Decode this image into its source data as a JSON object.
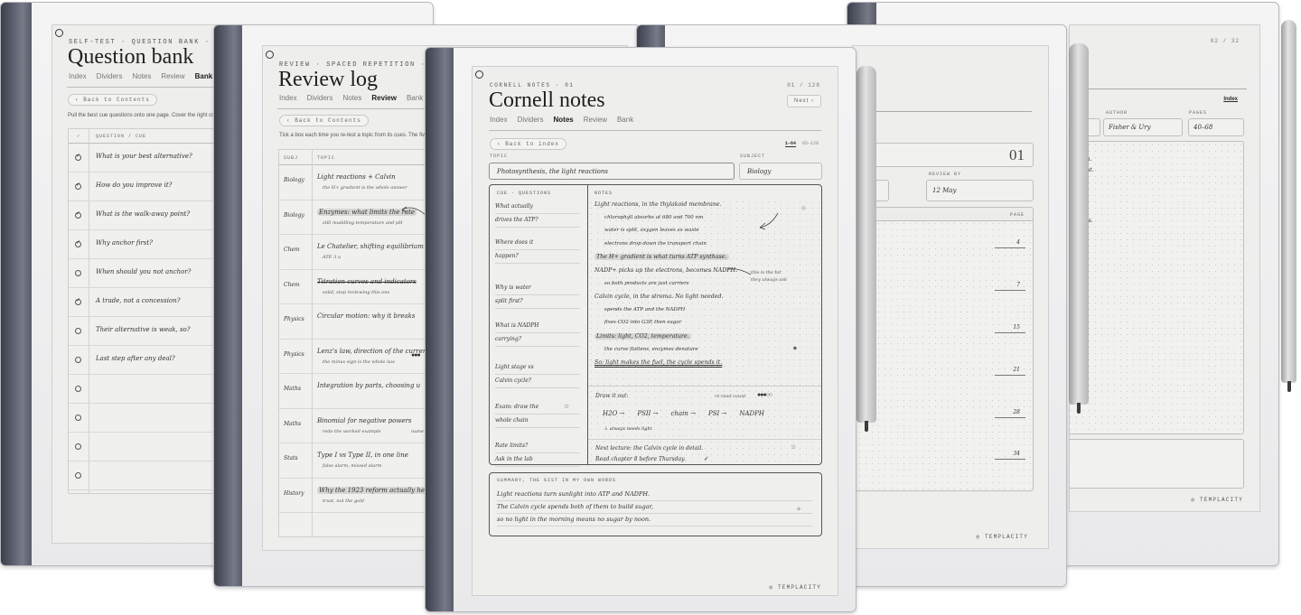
{
  "qbank": {
    "kicker": "SELF-TEST · QUESTION BANK · 01",
    "title": "Question bank",
    "tabs": [
      "Index",
      "Dividers",
      "Notes",
      "Review",
      "Bank"
    ],
    "active_tab": "Bank",
    "back": "‹ Back to Contents",
    "instruction": "Pull the best cue questions onto one page. Cover the right co",
    "col_check": "✓",
    "col_question": "QUESTION / CUE",
    "rows": [
      {
        "checked": true,
        "text": "What is your best alternative?"
      },
      {
        "checked": true,
        "text": "How do you improve it?"
      },
      {
        "checked": true,
        "text": "What is the walk-away point?"
      },
      {
        "checked": true,
        "text": "Why anchor first?"
      },
      {
        "checked": false,
        "text": "When should you not anchor?"
      },
      {
        "checked": true,
        "text": "A trade, not a concession?"
      },
      {
        "checked": false,
        "text": "Their alternative is weak, so?"
      },
      {
        "checked": false,
        "text": "Last step after any deal?"
      },
      {
        "checked": false,
        "text": ""
      },
      {
        "checked": false,
        "text": ""
      },
      {
        "checked": false,
        "text": ""
      },
      {
        "checked": false,
        "text": ""
      }
    ]
  },
  "review": {
    "kicker": "REVIEW · SPACED REPETITION · 01",
    "title": "Review log",
    "tabs": [
      "Index",
      "Dividers",
      "Notes",
      "Review",
      "Bank"
    ],
    "active_tab": "Review",
    "back": "‹ Back to Contents",
    "instruction": "Tick a box each time you re-test a topic from its cues. The fiv",
    "col_subject": "SUBJ",
    "col_topic": "TOPIC",
    "rows": [
      {
        "subject": "Biology",
        "topic": "Light reactions + Calvin",
        "note": "the H+ gradient is the whole answer",
        "style": "plain"
      },
      {
        "subject": "Biology",
        "topic": "Enzymes: what limits the rate",
        "note": "still muddling temperature and pH",
        "style": "hl"
      },
      {
        "subject": "Chem",
        "topic": "Le Chatelier, shifting equilibrium",
        "note": "ATP. 3 a",
        "style": "plain"
      },
      {
        "subject": "Chem",
        "topic": "Titration curves and indicators",
        "note": "solid, stop reviewing this one",
        "style": "strike"
      },
      {
        "subject": "Physics",
        "topic": "Circular motion: why it breaks",
        "note": "",
        "style": "plain"
      },
      {
        "subject": "Physics",
        "topic": "Lenz's law, direction of the current",
        "note": "the minus sign is the whole law",
        "style": "plain"
      },
      {
        "subject": "Maths",
        "topic": "Integration by parts, choosing u",
        "note": "",
        "style": "plain"
      },
      {
        "subject": "Maths",
        "topic": "Binomial for negative powers",
        "note": "redo the worked example",
        "style": "plain"
      },
      {
        "subject": "Stats",
        "topic": "Type I vs Type II, in one line",
        "note": "false alarm, missed alarm",
        "style": "plain"
      },
      {
        "subject": "History",
        "topic": "Why the 1923 reform actually held",
        "note": "trust, not the gold",
        "style": "hl"
      }
    ],
    "side_note": "name the"
  },
  "cornell": {
    "kicker": "CORNELL NOTES · 01",
    "page_count": "01 / 128",
    "next": "Next ›",
    "title": "Cornell notes",
    "tabs": [
      "Index",
      "Dividers",
      "Notes",
      "Review",
      "Bank"
    ],
    "active_tab": "Notes",
    "back": "‹ Back to index",
    "range_active": "1–64",
    "range_other": "65–128",
    "topic_label": "TOPIC",
    "topic_value": "Photosynthesis, the light reactions",
    "subject_label": "SUBJECT",
    "subject_value": "Biology",
    "cue_header": "CUE · QUESTIONS",
    "notes_header": "NOTES",
    "cues": [
      [
        "What actually",
        "drives the ATP?"
      ],
      [
        "Where does it",
        "happen?"
      ],
      [
        "Why is water",
        "split first?"
      ],
      [
        "What is NADPH",
        "carrying?"
      ],
      [
        "Light stage vs",
        "Calvin cycle?"
      ],
      [
        "Exam: draw the",
        "whole chain"
      ],
      [
        "Rate limits?",
        "Ask in the lab"
      ]
    ],
    "notes": [
      {
        "text": "Light reactions, in the thylakoid membrane.",
        "indent": 0,
        "style": "plain"
      },
      {
        "text": "chlorophyll absorbs at 680 and 700 nm",
        "indent": 1,
        "style": "plain"
      },
      {
        "text": "water is split, oxygen leaves as waste",
        "indent": 1,
        "style": "plain"
      },
      {
        "text": "electrons drop down the transport chain",
        "indent": 1,
        "style": "plain"
      },
      {
        "text": "The H+ gradient is what turns ATP synthase.",
        "indent": 0,
        "style": "hl"
      },
      {
        "text": "NADP+ picks up the electrons, becomes NADPH.",
        "indent": 0,
        "style": "plain"
      },
      {
        "text": "so both products are just carriers",
        "indent": 1,
        "style": "plain"
      },
      {
        "text": "Calvin cycle, in the stroma. No light needed.",
        "indent": 0,
        "style": "plain"
      },
      {
        "text": "spends the ATP and the NADPH",
        "indent": 1,
        "style": "plain"
      },
      {
        "text": "fixes CO2 into G3P, then sugar",
        "indent": 1,
        "style": "plain"
      },
      {
        "text": "Limits: light, CO2, temperature.",
        "indent": 0,
        "style": "hl"
      },
      {
        "text": "the curve flattens, enzymes denature",
        "indent": 1,
        "style": "plain"
      },
      {
        "text": "So: light makes the fuel, the cycle spends it.",
        "indent": 0,
        "style": "underline"
      }
    ],
    "margin_note": [
      "this is the bit",
      "they always ask"
    ],
    "draw_label": "Draw it out:",
    "reread_label": "re-read count",
    "flow": [
      "H2O →",
      "PSII →",
      "chain →",
      "PSI →",
      "NADPH"
    ],
    "flow_note": "↳ always needs light",
    "next_lecture": "Next lecture: the Calvin cycle in detail.",
    "read_chapter": "Read chapter 8 before Thursday.",
    "summary_label": "SUMMARY, THE GIST IN MY OWN WORDS",
    "summary": [
      "Light reactions turn sunlight into ATP and NADPH.",
      "The Calvin cycle spends both of them to build sugar,",
      "so no light in the morning means no sugar by noon."
    ],
    "brand": "TEMPLACITY"
  },
  "plan": {
    "big_number": "01",
    "review_by_label": "REVIEW BY",
    "review_by_value": "12 May",
    "page_label": "PAGE",
    "pages": [
      "4",
      "7",
      "15",
      "21",
      "28",
      "34"
    ],
    "brand": "TEMPLACITY"
  },
  "reading": {
    "page_count": "02 / 32",
    "index_link": "Index",
    "author_label": "AUTHOR",
    "author_value": "Fisher & Ury",
    "pages_label": "PAGES",
    "pages_value": "40–68",
    "snippets": [
      "roblem.",
      "ey want.",
      "ic",
      "",
      "",
      "nt talks.",
      "ng."
    ],
    "brand": "TEMPLACITY"
  }
}
